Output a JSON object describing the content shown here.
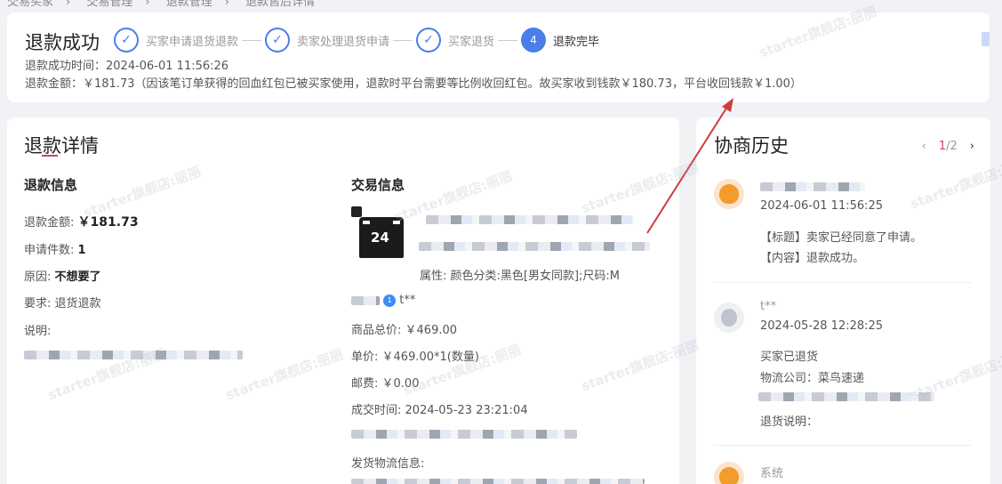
{
  "breadcrumb": [
    "交易买家",
    "交易管理",
    "退款管理",
    "退款售后详情"
  ],
  "status": {
    "title": "退款成功",
    "steps": [
      {
        "index": "✓",
        "label": "买家申请退货退款"
      },
      {
        "index": "✓",
        "label": "卖家处理退货申请"
      },
      {
        "index": "✓",
        "label": "买家退货"
      },
      {
        "index": "4",
        "label": "退款完毕"
      }
    ],
    "time_line": "退款成功时间：2024-06-01 11:56:26",
    "amount_line": "退款金额：￥181.73（因该笔订单获得的回血红包已被买家使用，退款时平台需要等比例收回红包。故买家收到钱款￥180.73，平台收回钱款￥1.00）"
  },
  "detail": {
    "title": "退款详情",
    "refund_info": {
      "heading": "退款信息",
      "amount_label": "退款金额:",
      "amount_value": "￥181.73",
      "count_label": "申请件数:",
      "count_value": "1",
      "reason_label": "原因:",
      "reason_value": "不想要了",
      "request_label": "要求:",
      "request_value": "退货退款",
      "note_label": "说明:"
    },
    "trade_info": {
      "heading": "交易信息",
      "attributes": "属性: 颜色分类:黑色[男女同款];尺码:M",
      "buyer_name": "t**",
      "total_label": "商品总价:",
      "total_value": "￥469.00",
      "unit_label": "单价:",
      "unit_value": "￥469.00*1(数量)",
      "shipping_label": "邮费:",
      "shipping_value": "￥0.00",
      "deal_time_label": "成交时间:",
      "deal_time_value": "2024-05-23 23:21:04",
      "logistics_label": "发货物流信息:",
      "jersey_number": "24"
    }
  },
  "history": {
    "title": "协商历史",
    "page": "1",
    "page_total": "/2",
    "entries": [
      {
        "time": "2024-06-01 11:56:25",
        "line1": "【标题】卖家已经同意了申请。",
        "line2": "【内容】退款成功。"
      },
      {
        "name": "t**",
        "time": "2024-05-28 12:28:25",
        "line1": "买家已退货",
        "line2": "物流公司：菜鸟速递",
        "line3": "退货说明："
      },
      {
        "name": "系统"
      }
    ]
  },
  "watermark_text": "starter旗舰店:丽丽",
  "colors": {
    "accent": "#4a7ee8",
    "underline": "#e0396b",
    "arrow": "#d23b3b"
  }
}
